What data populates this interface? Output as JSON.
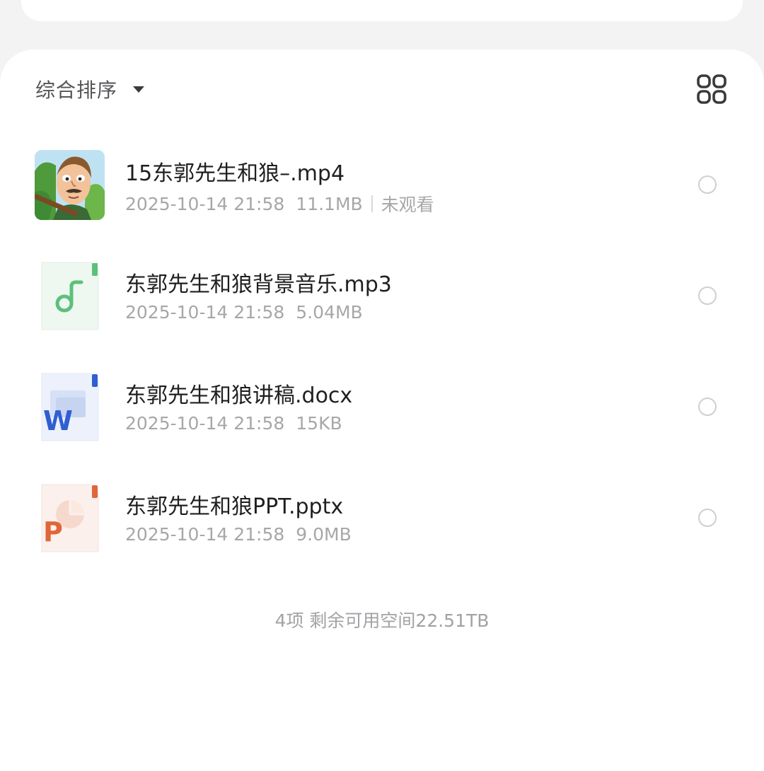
{
  "toolbar": {
    "sort_label": "综合排序",
    "sort_icon": "caret-down-icon",
    "view_toggle_icon": "grid-view-icon"
  },
  "files": [
    {
      "name": "15东郭先生和狼–.mp4",
      "date": "2025-10-14 21:58",
      "size": "11.1MB",
      "status": "未观看",
      "icon": "video-thumbnail",
      "selected": false
    },
    {
      "name": "东郭先生和狼背景音乐.mp3",
      "date": "2025-10-14 21:58",
      "size": "5.04MB",
      "icon": "audio-file-icon",
      "selected": false
    },
    {
      "name": "东郭先生和狼讲稿.docx",
      "date": "2025-10-14 21:58",
      "size": "15KB",
      "icon": "word-file-icon",
      "selected": false
    },
    {
      "name": "东郭先生和狼PPT.pptx",
      "date": "2025-10-14 21:58",
      "size": "9.0MB",
      "icon": "powerpoint-file-icon",
      "selected": false
    }
  ],
  "footer": {
    "summary": "4项 剩余可用空间22.51TB"
  },
  "colors": {
    "page_background": "#f3f3f4",
    "panel_background": "#ffffff",
    "audio_green": "#5cc07a",
    "word_blue": "#2f5fd0",
    "ppt_orange": "#e0663a"
  }
}
